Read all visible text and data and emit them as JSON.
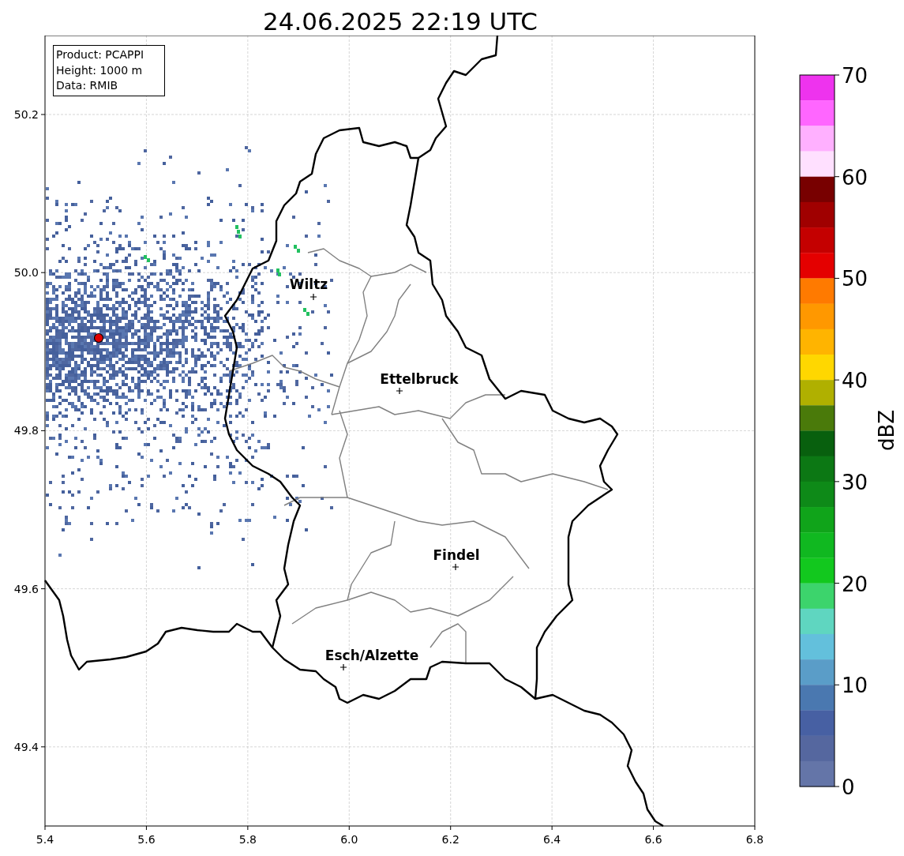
{
  "title": "24.06.2025 22:19 UTC",
  "info_box": [
    "Product: PCAPPI",
    "Height: 1000 m",
    "Data: RMIB"
  ],
  "map": {
    "x_ticks": [
      "5.4",
      "5.6",
      "5.8",
      "6.0",
      "6.2",
      "6.4",
      "6.6",
      "6.8"
    ],
    "y_ticks": [
      "50.2",
      "50.0",
      "49.8",
      "49.6",
      "49.4"
    ],
    "cities": [
      "Wiltz",
      "Ettelbruck",
      "Findel",
      "Esch/Alzette"
    ]
  },
  "colorbar": {
    "label": "dBZ",
    "ticks": [
      "70",
      "60",
      "50",
      "40",
      "30",
      "20",
      "10",
      "0"
    ],
    "segments": [
      {
        "color": "#ee33ee"
      },
      {
        "color": "#ff66ff"
      },
      {
        "color": "#ffb0ff"
      },
      {
        "color": "#ffe0ff"
      },
      {
        "color": "#780000"
      },
      {
        "color": "#a00000"
      },
      {
        "color": "#c40000"
      },
      {
        "color": "#e40000"
      },
      {
        "color": "#ff7a00"
      },
      {
        "color": "#ff9800"
      },
      {
        "color": "#ffb400"
      },
      {
        "color": "#ffd700"
      },
      {
        "color": "#b0b000"
      },
      {
        "color": "#4a7a0a"
      },
      {
        "color": "#08600e"
      },
      {
        "color": "#0c7814"
      },
      {
        "color": "#0e8a18"
      },
      {
        "color": "#10a41a"
      },
      {
        "color": "#10b820"
      },
      {
        "color": "#12c81e"
      },
      {
        "color": "#3cd46c"
      },
      {
        "color": "#5fd6c0"
      },
      {
        "color": "#63c0dc"
      },
      {
        "color": "#5a9dc8"
      },
      {
        "color": "#4a78b0"
      },
      {
        "color": "#4760a3"
      },
      {
        "color": "#55679f"
      },
      {
        "color": "#6475a8"
      }
    ]
  }
}
